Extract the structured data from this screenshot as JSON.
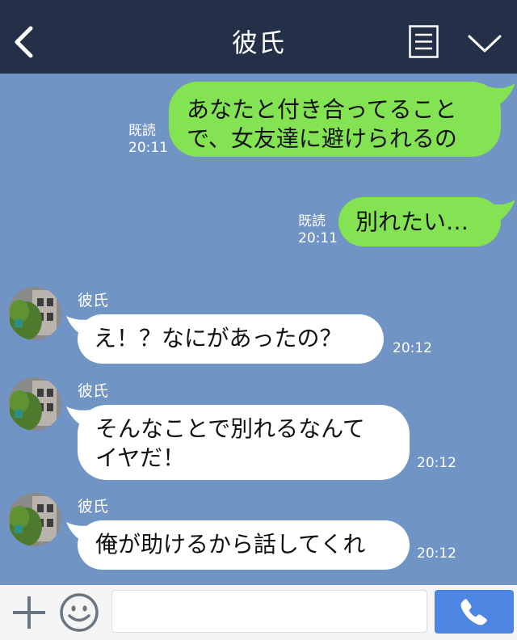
{
  "header": {
    "title": "彼氏",
    "back_icon": "chevron-left-icon",
    "notes_icon": "notes-icon",
    "menu_icon": "chevron-down-icon"
  },
  "messages": [
    {
      "direction": "out",
      "text": "あなたと付き合ってること\nで、女友達に避けられるの",
      "read": "既読",
      "time": "20:11"
    },
    {
      "direction": "out",
      "text": "別れたい…",
      "read": "既読",
      "time": "20:11"
    },
    {
      "direction": "in",
      "sender": "彼氏",
      "text": "え！？なにがあったの？",
      "time": "20:12"
    },
    {
      "direction": "in",
      "sender": "彼氏",
      "text": "そんなことで別れるなんて\nイヤだ！",
      "time": "20:12"
    },
    {
      "direction": "in",
      "sender": "彼氏",
      "text": "俺が助けるから話してくれ",
      "time": "20:12"
    }
  ],
  "input_bar": {
    "plus_icon": "plus-icon",
    "emoji_icon": "emoji-icon",
    "message_value": "",
    "call_icon": "phone-icon"
  },
  "colors": {
    "header_bg": "#242f48",
    "chat_bg": "#7094c3",
    "outgoing_bubble": "#84e352",
    "incoming_bubble": "#ffffff",
    "call_button": "#4e86e3"
  }
}
